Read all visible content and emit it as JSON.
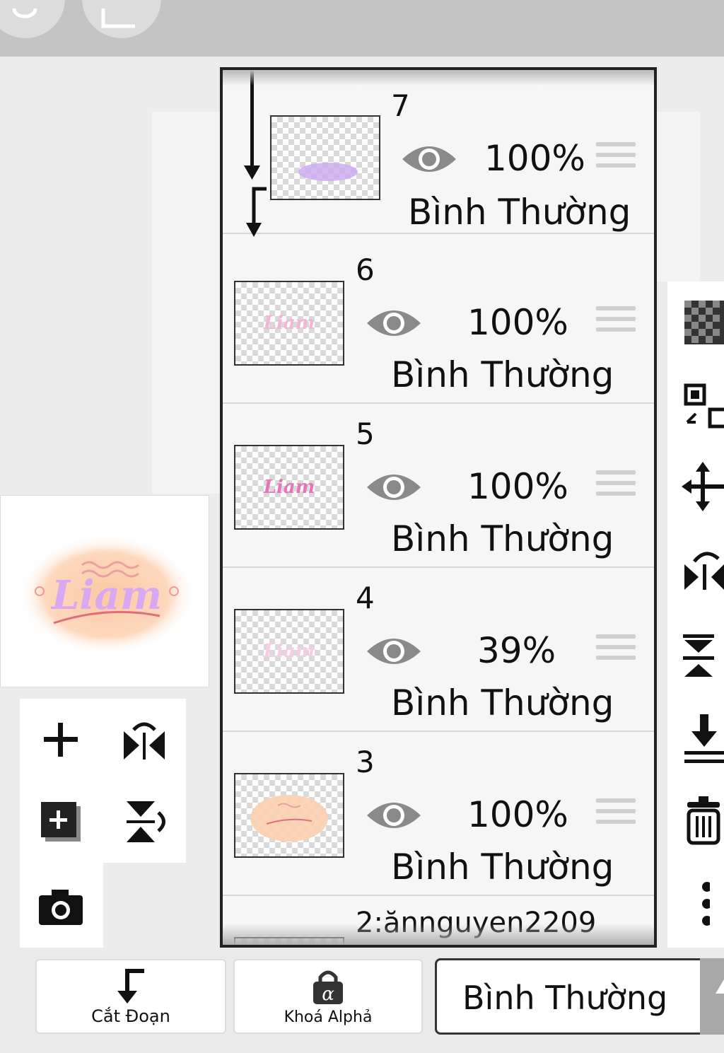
{
  "layers": [
    {
      "number": "7",
      "opacity": "100%",
      "blend": "Bình Thường",
      "thumb_text": ""
    },
    {
      "number": "6",
      "opacity": "100%",
      "blend": "Bình Thường",
      "thumb_text": "Liam"
    },
    {
      "number": "5",
      "opacity": "100%",
      "blend": "Bình Thường",
      "thumb_text": "Liam"
    },
    {
      "number": "4",
      "opacity": "39%",
      "blend": "Bình Thường",
      "thumb_text": "Liam"
    },
    {
      "number": "3",
      "opacity": "100%",
      "blend": "Bình Thường",
      "thumb_text": ""
    },
    {
      "number": "2:ănnguyen2209"
    }
  ],
  "preview": {
    "text": "Liam"
  },
  "bottom": {
    "clip_label": "Cắt Đoạn",
    "alpha_lock_label": "Khoá Alphả",
    "blend_mode_value": "Bình Thường"
  },
  "colors": {
    "accent_pink": "#e774b8",
    "peach": "#fcd0b0",
    "lavender": "#c9a8f0"
  }
}
